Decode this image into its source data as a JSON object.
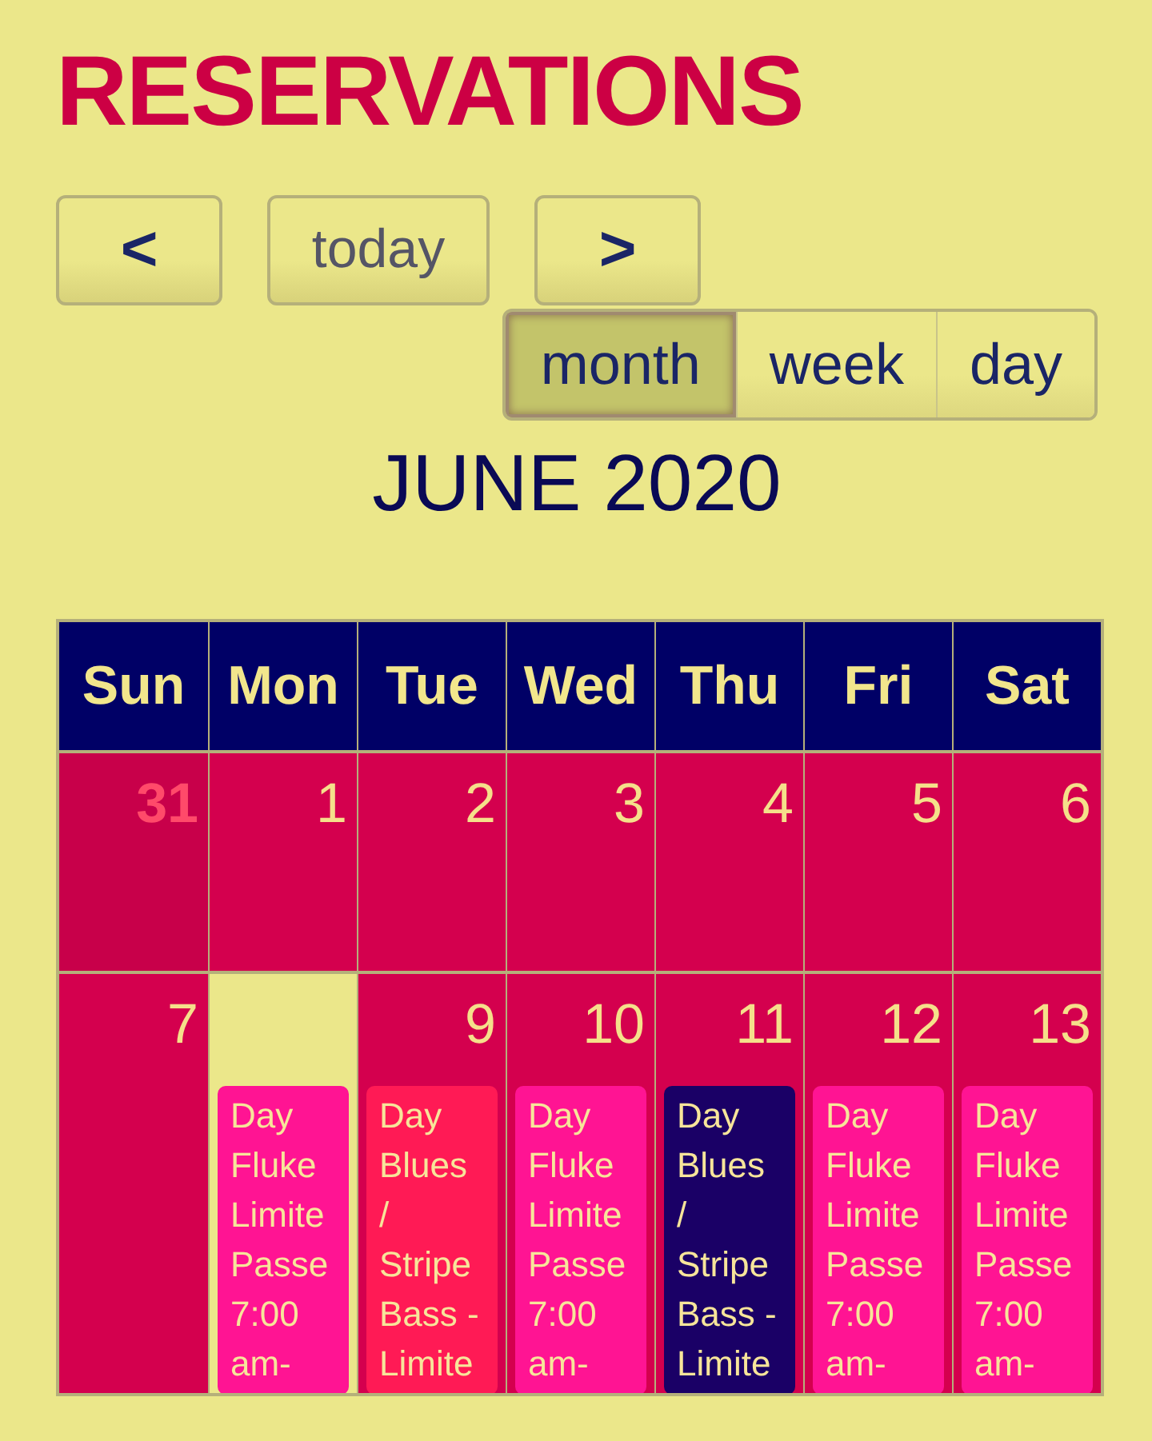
{
  "title": "RESERVATIONS",
  "nav": [
    {
      "kind": "prev",
      "label": "<"
    },
    {
      "kind": "today",
      "label": "today"
    },
    {
      "kind": "next",
      "label": ">"
    }
  ],
  "views": [
    {
      "label": "month",
      "selected": true
    },
    {
      "label": "week",
      "selected": false
    },
    {
      "label": "day",
      "selected": false
    }
  ],
  "month_title": "JUNE 2020",
  "weekdays": [
    "Sun",
    "Mon",
    "Tue",
    "Wed",
    "Thu",
    "Fri",
    "Sat"
  ],
  "weeks": [
    {
      "days": [
        {
          "number": "31",
          "other_month": true,
          "today": false
        },
        {
          "number": "1",
          "other_month": false,
          "today": false
        },
        {
          "number": "2",
          "other_month": false,
          "today": false
        },
        {
          "number": "3",
          "other_month": false,
          "today": false
        },
        {
          "number": "4",
          "other_month": false,
          "today": false
        },
        {
          "number": "5",
          "other_month": false,
          "today": false
        },
        {
          "number": "6",
          "other_month": false,
          "today": false
        }
      ]
    },
    {
      "days": [
        {
          "number": "7",
          "other_month": false,
          "today": false
        },
        {
          "other_month": false,
          "today": true,
          "events": [
            {
              "title": "Day Fluke Limite Passe 7:00 am-",
              "color": "#ff1493"
            }
          ]
        },
        {
          "number": "9",
          "other_month": false,
          "today": false,
          "events": [
            {
              "title": "Day Blues / Stripe Bass - Limite",
              "color": "#ff1a55"
            }
          ]
        },
        {
          "number": "10",
          "other_month": false,
          "today": false,
          "events": [
            {
              "title": "Day Fluke Limite Passe 7:00 am-",
              "color": "#ff1493"
            }
          ]
        },
        {
          "number": "11",
          "other_month": false,
          "today": false,
          "events": [
            {
              "title": "Day Blues / Stripe Bass - Limite",
              "color": "#1a0066"
            }
          ]
        },
        {
          "number": "12",
          "other_month": false,
          "today": false,
          "events": [
            {
              "title": "Day Fluke Limite Passe 7:00 am-",
              "color": "#ff1493"
            }
          ]
        },
        {
          "number": "13",
          "other_month": false,
          "today": false,
          "events": [
            {
              "title": "Day Fluke Limite Passe 7:00 am-",
              "color": "#ff1493"
            }
          ]
        }
      ]
    }
  ]
}
